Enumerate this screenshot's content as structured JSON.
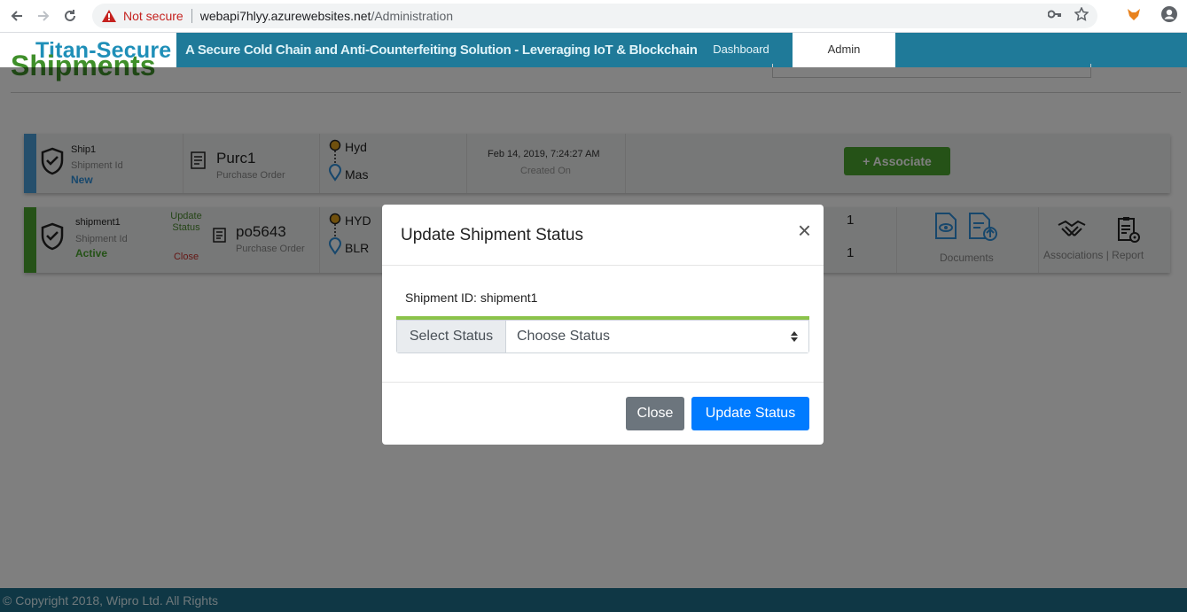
{
  "browser": {
    "security_label": "Not secure",
    "url_host": "webapi7hlyy.azurewebsites.net",
    "url_path": "/Administration"
  },
  "header": {
    "brand": "Titan-Secure",
    "tagline": "A Secure Cold Chain and Anti-Counterfeiting Solution - Leveraging IoT & Blockchain",
    "nav": {
      "dashboard": "Dashboard",
      "admin": "Admin"
    }
  },
  "page": {
    "title": "Shipments"
  },
  "shipments": [
    {
      "id": "Ship1",
      "id_label": "Shipment Id",
      "status": "New",
      "status_color": "#2f8fd8",
      "bar_color": "#4a9fd8",
      "po": "Purc1",
      "po_label": "Purchase Order",
      "from": "Hyd",
      "to": "Mas",
      "created": "Feb 14, 2019, 7:24:27 AM",
      "created_label": "Created On",
      "associate_label": "+ Associate"
    },
    {
      "id": "shipment1",
      "id_label": "Shipment Id",
      "status": "Active",
      "status_color": "#4aa52e",
      "bar_color": "#4aa52e",
      "update_label": "Update Status",
      "close_label": "Close",
      "po": "po5643",
      "po_label": "Purchase Order",
      "from": "HYD",
      "to": "BLR",
      "count_top": "1",
      "count_bottom": "1",
      "documents_label": "Documents",
      "associations_report_label": "Associations | Report"
    }
  ],
  "footer": {
    "text": "© Copyright 2018, Wipro Ltd. All Rights"
  },
  "modal": {
    "title": "Update Shipment Status",
    "shipment_id_line": "Shipment ID: shipment1",
    "select_addon": "Select Status",
    "select_value": "Choose Status",
    "close_button": "Close",
    "update_button": "Update Status"
  }
}
